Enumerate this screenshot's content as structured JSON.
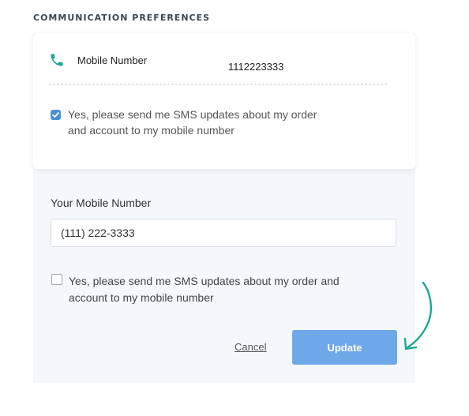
{
  "section": {
    "title": "COMMUNICATION PREFERENCES"
  },
  "summary_card": {
    "icon": "phone-icon",
    "label": "Mobile Number",
    "value": "1112223333",
    "consent_checked": true,
    "consent_text": "Yes, please send me SMS updates about my order and account to my mobile number"
  },
  "form": {
    "field_label": "Your Mobile Number",
    "mobile_value": "(111) 222-3333",
    "consent_checked": false,
    "consent_text": "Yes, please send me SMS updates about my order and account to my mobile number",
    "cancel_label": "Cancel",
    "update_label": "Update"
  },
  "colors": {
    "icon_accent": "#1aa88f",
    "checkbox_checked": "#4d8fd8",
    "button": "#6fa8e8",
    "panel_bg": "#f4f8fb",
    "annotation_arrow": "#1aa88f"
  }
}
